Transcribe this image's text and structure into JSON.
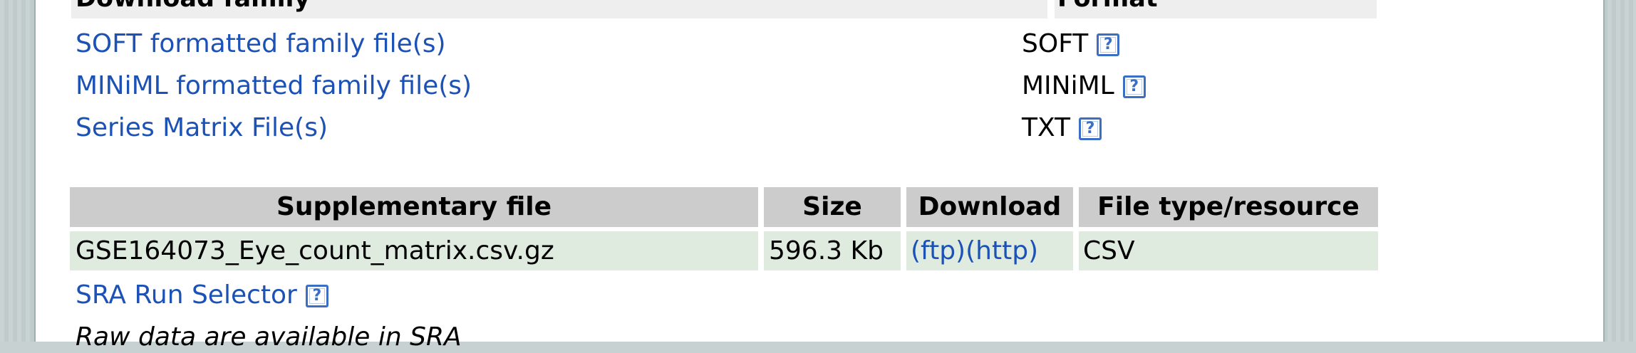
{
  "family_table": {
    "header_left": "Download family",
    "header_right": "Format",
    "rows": [
      {
        "label": "SOFT formatted family file(s)",
        "format": "SOFT"
      },
      {
        "label": "MINiML formatted family file(s)",
        "format": "MINiML"
      },
      {
        "label": "Series Matrix File(s)",
        "format": "TXT"
      }
    ]
  },
  "supplementary_table": {
    "headers": [
      "Supplementary file",
      "Size",
      "Download",
      "File type/resource"
    ],
    "row": {
      "file": "GSE164073_Eye_count_matrix.csv.gz",
      "size": "596.3 Kb",
      "ftp": "(ftp)",
      "http": "(http)",
      "type": "CSV"
    }
  },
  "sra": {
    "link": "SRA Run Selector",
    "note": "Raw data are available in SRA"
  },
  "help_glyph": "?",
  "icons": {
    "help": "help-icon"
  },
  "colors": {
    "link": "#1c52b5",
    "header_bg": "#eeeeee",
    "supp_header_bg": "#cccccc",
    "supp_row_bg": "#dfebdf"
  }
}
